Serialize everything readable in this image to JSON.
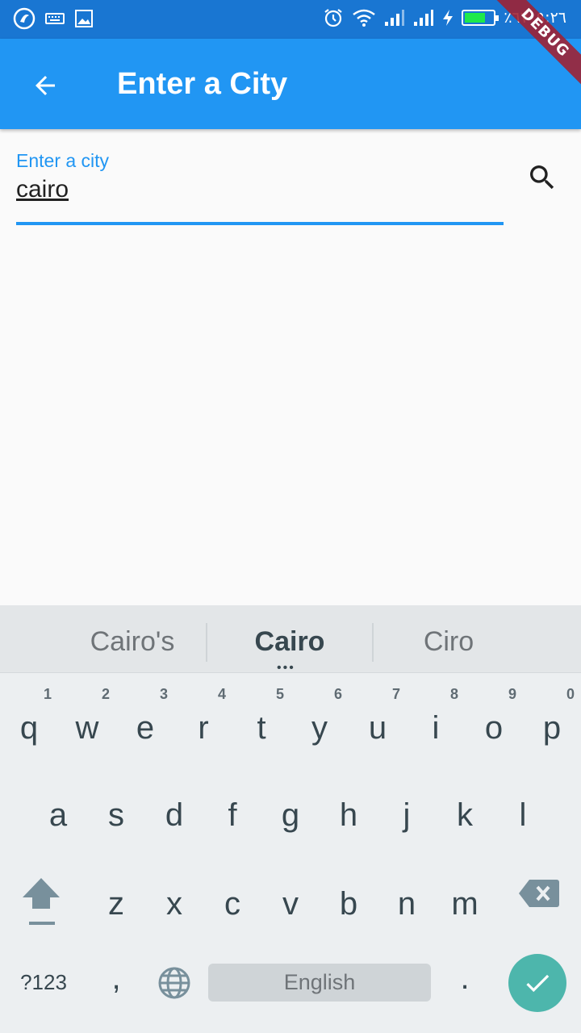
{
  "status_bar": {
    "time": "٩:٢٦",
    "battery_text": "٪٦٧",
    "battery_level": 0.64
  },
  "debug_banner": "DEBUG",
  "app_bar": {
    "title": "Enter a City",
    "back_icon": "arrow-back-icon"
  },
  "city_field": {
    "label": "Enter a city",
    "value": "cairo",
    "search_icon": "search-icon"
  },
  "keyboard": {
    "suggestions": [
      "Cairo's",
      "Cairo",
      "Ciro"
    ],
    "row1": [
      {
        "ch": "q",
        "num": "1"
      },
      {
        "ch": "w",
        "num": "2"
      },
      {
        "ch": "e",
        "num": "3"
      },
      {
        "ch": "r",
        "num": "4"
      },
      {
        "ch": "t",
        "num": "5"
      },
      {
        "ch": "y",
        "num": "6"
      },
      {
        "ch": "u",
        "num": "7"
      },
      {
        "ch": "i",
        "num": "8"
      },
      {
        "ch": "o",
        "num": "9"
      },
      {
        "ch": "p",
        "num": "0"
      }
    ],
    "row2": [
      "a",
      "s",
      "d",
      "f",
      "g",
      "h",
      "j",
      "k",
      "l"
    ],
    "row3": [
      "z",
      "x",
      "c",
      "v",
      "b",
      "n",
      "m"
    ],
    "symbols_label": "?123",
    "comma_label": ",",
    "space_label": "English",
    "period_label": "."
  },
  "colors": {
    "primary": "#2196f3",
    "primary_dark": "#1976d2",
    "accent_done": "#4db6ac"
  }
}
